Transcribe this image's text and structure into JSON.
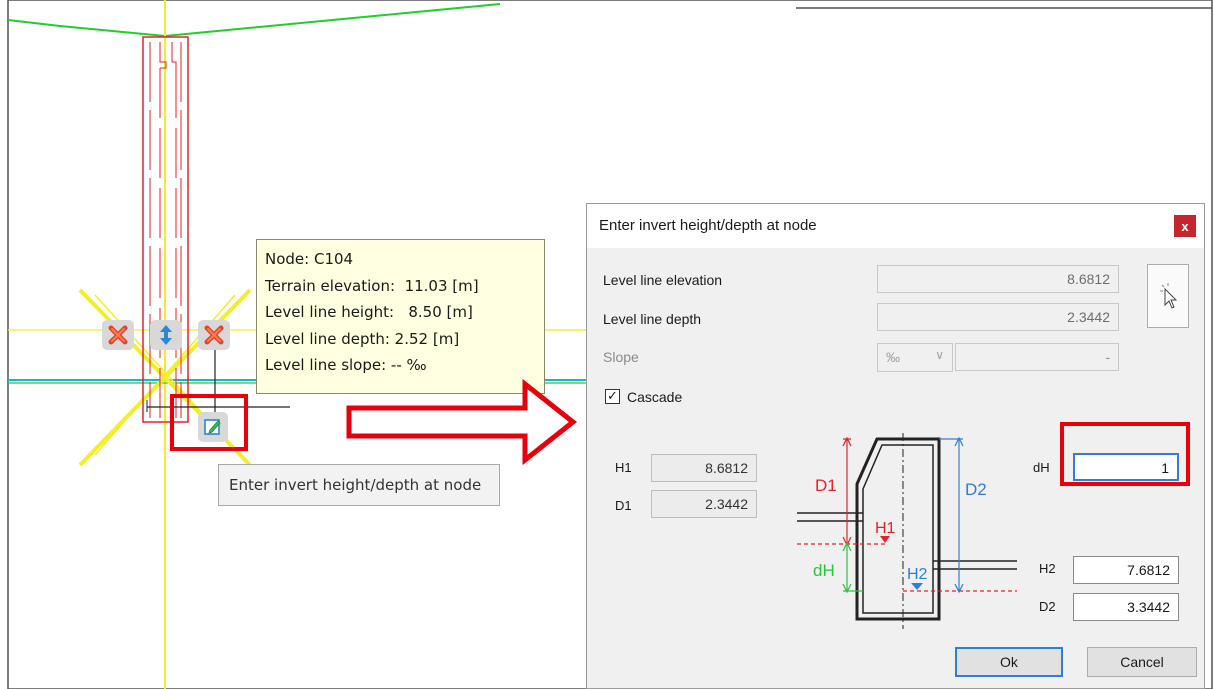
{
  "node_tooltip": {
    "node": "Node: C104",
    "terrain": "Terrain elevation:  11.03 [m]",
    "height": "Level line height:   8.50 [m]",
    "depth": "Level line depth: 2.52 [m]",
    "slope": "Level line slope: -- ‰"
  },
  "hint_tooltip": "Enter invert height/depth at node",
  "dialog": {
    "title": "Enter invert height/depth at node",
    "close": "x",
    "level_line_elevation_label": "Level line elevation",
    "level_line_elevation_value": "8.6812",
    "level_line_depth_label": "Level line depth",
    "level_line_depth_value": "2.3442",
    "slope_label": "Slope",
    "slope_unit": "‰",
    "slope_value": "-",
    "cascade_label": "Cascade",
    "cascade_checked": true,
    "h1_label": "H1",
    "h1_value": "8.6812",
    "d1_label": "D1",
    "d1_value": "2.3442",
    "dh_label": "dH",
    "dh_value": "1",
    "h2_label": "H2",
    "h2_value": "7.6812",
    "d2_label": "D2",
    "d2_value": "3.3442",
    "ok": "Ok",
    "cancel": "Cancel",
    "diagram": {
      "d1": "D1",
      "d2": "D2",
      "h1": "H1",
      "h2": "H2",
      "dh": "dH"
    }
  },
  "colors": {
    "highlight": "#e8000b",
    "accent_blue": "#2f7ed8",
    "cad_red": "#e8202a",
    "cad_yellow": "#f2ef2a",
    "cad_green": "#1fcf2a",
    "cad_cyan": "#19b3d6",
    "diagram_green": "#2cc23a"
  },
  "icons": {
    "delete_left": "red-x-icon",
    "move": "vertical-arrows-icon",
    "delete_right": "red-x-icon",
    "edit": "edit-pencil-icon",
    "pick": "cursor-pick-icon",
    "arrow": "right-arrow-icon"
  }
}
